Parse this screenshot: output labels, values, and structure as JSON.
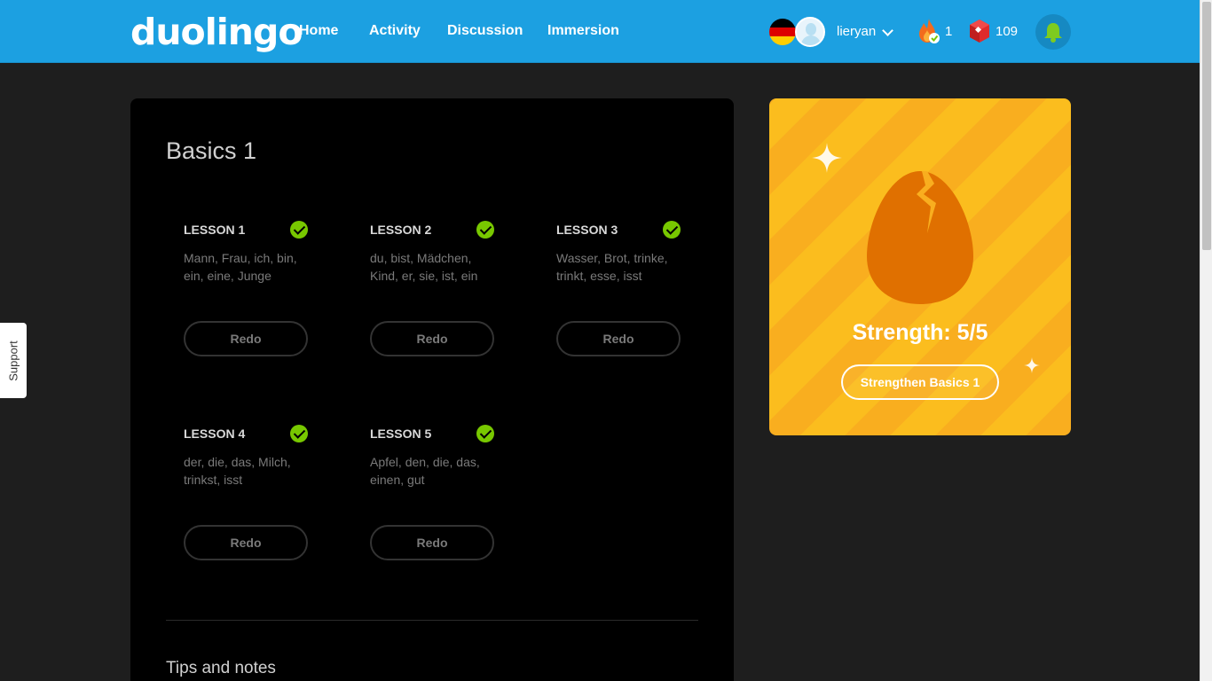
{
  "header": {
    "logo": "duolingo",
    "nav": {
      "home": "Home",
      "activity": "Activity",
      "discussion": "Discussion",
      "immersion": "Immersion"
    },
    "language_flag": "german-flag-icon",
    "username": "lieryan",
    "streak_count": "1",
    "lingot_count": "109",
    "bell_icon": "bell-icon",
    "accent_color": "#1ca0e1"
  },
  "support": {
    "label": "Support"
  },
  "skill": {
    "title": "Basics 1",
    "lessons": [
      {
        "title": "LESSON 1",
        "words": "Mann, Frau, ich, bin, ein, eine, Junge",
        "button": "Redo",
        "completed": true
      },
      {
        "title": "LESSON 2",
        "words": "du, bist, Mädchen, Kind, er, sie, ist, ein",
        "button": "Redo",
        "completed": true
      },
      {
        "title": "LESSON 3",
        "words": "Wasser, Brot, trinke, trinkt, esse, isst",
        "button": "Redo",
        "completed": true
      },
      {
        "title": "LESSON 4",
        "words": "der, die, das, Milch, trinkst, isst",
        "button": "Redo",
        "completed": true
      },
      {
        "title": "LESSON 5",
        "words": "Apfel, den, die, das, einen, gut",
        "button": "Redo",
        "completed": true
      }
    ],
    "tips_title": "Tips and notes"
  },
  "strength": {
    "label": "Strength: 5/5",
    "button": "Strengthen Basics 1",
    "level": 5,
    "max": 5,
    "card_color": "#f9ae1f",
    "egg_color": "#e07000"
  }
}
